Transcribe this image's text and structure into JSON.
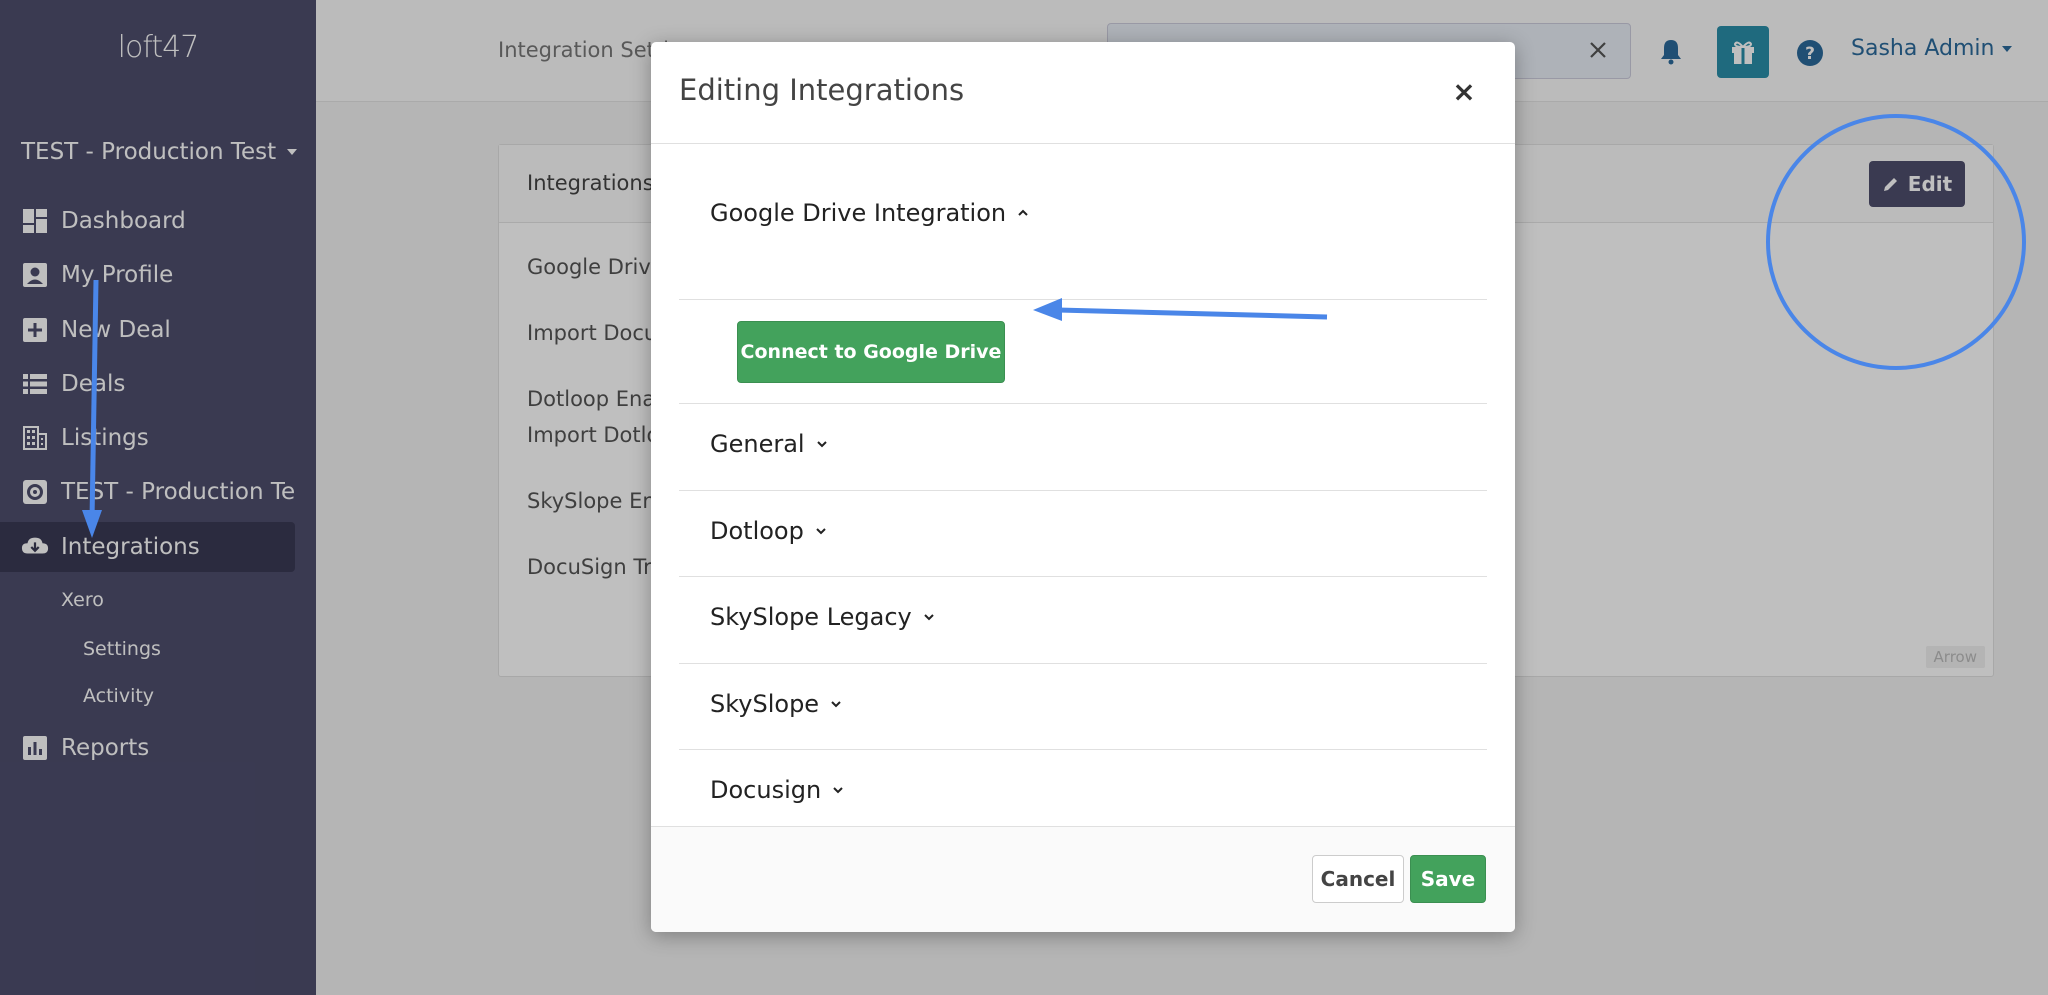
{
  "app": {
    "logo": "loft47"
  },
  "sidebar": {
    "workspace": "TEST - Production Test",
    "items": [
      {
        "label": "Dashboard",
        "icon": "dashboard-icon"
      },
      {
        "label": "My Profile",
        "icon": "profile-icon"
      },
      {
        "label": "New Deal",
        "icon": "plus-square-icon"
      },
      {
        "label": "Deals",
        "icon": "list-icon"
      },
      {
        "label": "Listings",
        "icon": "building-icon"
      },
      {
        "label": "TEST - Production Test",
        "icon": "gear-icon"
      },
      {
        "label": "Integrations",
        "icon": "cloud-download-icon"
      }
    ],
    "subitems": [
      {
        "label": "Xero"
      },
      {
        "label": "Settings"
      },
      {
        "label": "Activity"
      }
    ],
    "reports": {
      "label": "Reports",
      "icon": "bar-chart-icon"
    }
  },
  "topbar": {
    "breadcrumb": "Integration Settings",
    "search_value": "",
    "user_name": "Sasha Admin"
  },
  "card": {
    "title": "Integrations",
    "edit_label": "Edit",
    "rows": [
      "Google Drive",
      "Import Documents",
      "Dotloop Enabled",
      "Import Dotloop",
      "SkySlope Enabled",
      "DocuSign Tracking"
    ],
    "annotation_tag": "Arrow"
  },
  "modal": {
    "title": "Editing Integrations",
    "close": "×",
    "sections": [
      {
        "label": "Google Drive Integration",
        "expanded": true
      },
      {
        "label": "General",
        "expanded": false
      },
      {
        "label": "Dotloop",
        "expanded": false
      },
      {
        "label": "SkySlope Legacy",
        "expanded": false
      },
      {
        "label": "SkySlope",
        "expanded": false
      },
      {
        "label": "Docusign",
        "expanded": false
      }
    ],
    "connect_label": "Connect to Google Drive",
    "cancel_label": "Cancel",
    "save_label": "Save"
  },
  "colors": {
    "sidebar": "#4e4e6d",
    "sidebar_active": "#3a3a55",
    "primary_green": "#43a25c",
    "gift_teal": "#2a8ea8",
    "annotation_blue": "#4a86e8",
    "user_link": "#2b6a9b"
  }
}
